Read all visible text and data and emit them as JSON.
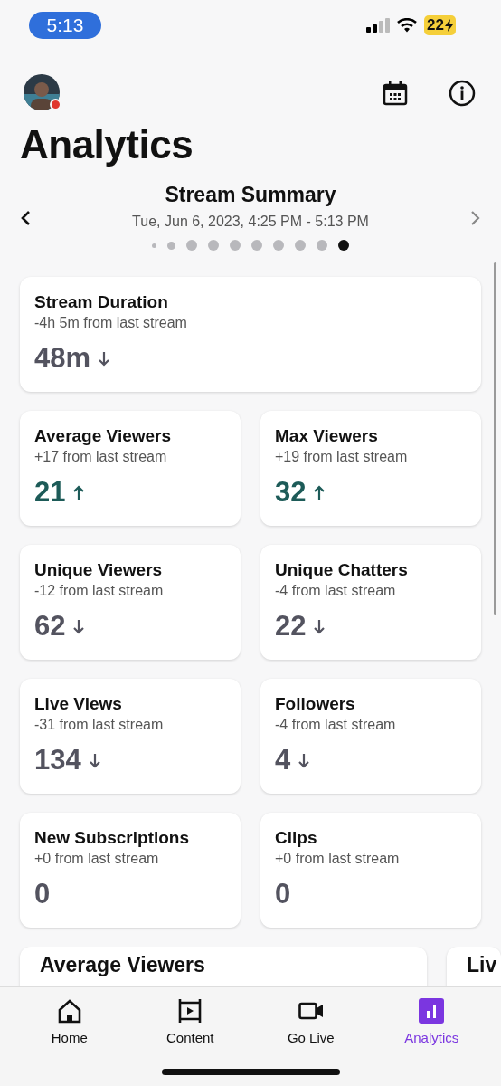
{
  "status_bar": {
    "time": "5:13",
    "battery": "22"
  },
  "title": "Analytics",
  "summary": {
    "title": "Stream Summary",
    "date": "Tue, Jun 6, 2023, 4:25 PM - 5:13 PM"
  },
  "pages": [
    {
      "selected": false
    },
    {
      "selected": false
    },
    {
      "selected": false
    },
    {
      "selected": false
    },
    {
      "selected": false
    },
    {
      "selected": false
    },
    {
      "selected": false
    },
    {
      "selected": false
    },
    {
      "selected": false
    },
    {
      "selected": true
    }
  ],
  "stats": [
    {
      "label": "Stream Duration",
      "change": "-4h 5m from last stream",
      "value": "48m",
      "kind": "falling",
      "wide": true
    },
    {
      "label": "Average Viewers",
      "change": "+17 from last stream",
      "value": "21",
      "kind": "rising",
      "wide": false
    },
    {
      "label": "Max Viewers",
      "change": "+19 from last stream",
      "value": "32",
      "kind": "rising",
      "wide": false
    },
    {
      "label": "Unique Viewers",
      "change": "-12 from last stream",
      "value": "62",
      "kind": "falling",
      "wide": false
    },
    {
      "label": "Unique Chatters",
      "change": "-4 from last stream",
      "value": "22",
      "kind": "falling",
      "wide": false
    },
    {
      "label": "Live Views",
      "change": "-31 from last stream",
      "value": "134",
      "kind": "falling",
      "wide": false
    },
    {
      "label": "Followers",
      "change": "-4 from last stream",
      "value": "4",
      "kind": "falling",
      "wide": false
    },
    {
      "label": "New Subscriptions",
      "change": "+0 from last stream",
      "value": "0",
      "kind": "flat",
      "wide": false
    },
    {
      "label": "Clips",
      "change": "+0 from last stream",
      "value": "0",
      "kind": "flat",
      "wide": false
    }
  ],
  "charts": [
    {
      "title": "Average Viewers"
    },
    {
      "title": "Liv"
    }
  ],
  "tabs": [
    {
      "label": "Home",
      "kind": "home",
      "selected": false
    },
    {
      "label": "Content",
      "kind": "content",
      "selected": false
    },
    {
      "label": "Go Live",
      "kind": "camera",
      "selected": false
    },
    {
      "label": "Analytics",
      "kind": "analytics",
      "selected": true
    }
  ]
}
